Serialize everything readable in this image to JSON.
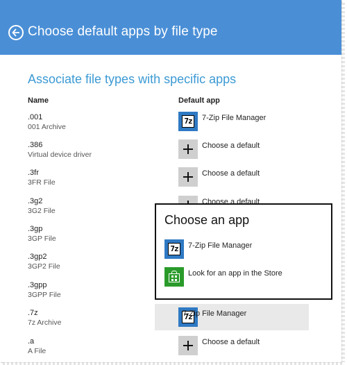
{
  "header": {
    "title": "Choose default apps by file type",
    "back_icon": "back-arrow-circle-icon"
  },
  "main": {
    "section_title": "Associate file types with specific apps",
    "columns": {
      "name": "Name",
      "app": "Default app"
    },
    "rows": [
      {
        "ext": ".001",
        "desc": "001 Archive",
        "app": "7-Zip File Manager",
        "icon": "7zip-icon"
      },
      {
        "ext": ".386",
        "desc": "Virtual device driver",
        "app": "Choose a default",
        "icon": "plus-icon"
      },
      {
        "ext": ".3fr",
        "desc": "3FR File",
        "app": "Choose a default",
        "icon": "plus-icon"
      },
      {
        "ext": ".3g2",
        "desc": "3G2 File",
        "app": "Choose a default",
        "icon": "plus-icon"
      },
      {
        "ext": ".3gp",
        "desc": "3GP File"
      },
      {
        "ext": ".3gp2",
        "desc": "3GP2 File"
      },
      {
        "ext": ".3gpp",
        "desc": "3GPP File"
      },
      {
        "ext": ".7z",
        "desc": "7z Archive",
        "app": "7-Zip File Manager",
        "icon": "7zip-icon"
      },
      {
        "ext": ".a",
        "desc": "A File",
        "app": "Choose a default",
        "icon": "plus-icon"
      }
    ]
  },
  "popup": {
    "title": "Choose an app",
    "items": [
      {
        "label": "7-Zip File Manager",
        "icon": "7zip-icon"
      },
      {
        "label": "Look for an app in the Store",
        "icon": "store-icon"
      }
    ]
  },
  "icon_text": {
    "zip": "7z"
  },
  "colors": {
    "header_bg": "#4a8fd6",
    "accent": "#3c9ad4",
    "zip_blue": "#2f79c3",
    "store_green": "#2a9b2a",
    "selected_bg": "#e9e9e9"
  }
}
